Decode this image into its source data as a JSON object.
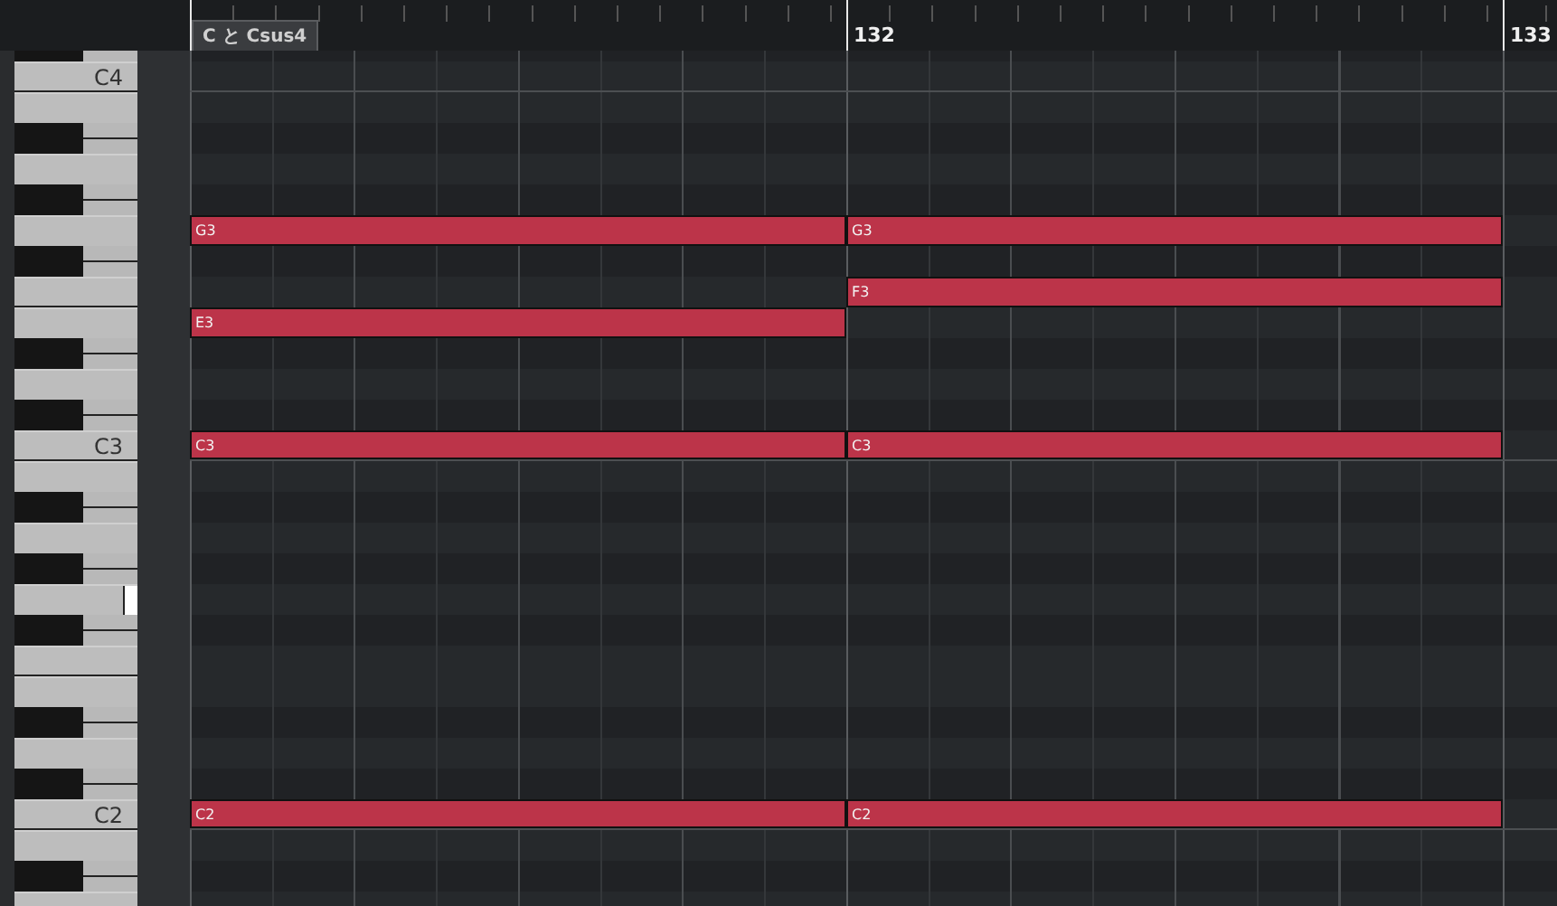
{
  "ruler": {
    "chord": "C と Csus4",
    "markers": [
      "132",
      "133"
    ]
  },
  "keys": [
    {
      "kind": "black",
      "highlighted": false
    },
    {
      "kind": "white-bottom",
      "label": "C4",
      "highlighted": false
    },
    {
      "kind": "white",
      "highlighted": false
    },
    {
      "kind": "black",
      "highlighted": false
    },
    {
      "kind": "white",
      "highlighted": false
    },
    {
      "kind": "black",
      "highlighted": false
    },
    {
      "kind": "white",
      "highlighted": false,
      "notes": [
        {
          "label": "G3",
          "kind": "first-bar"
        },
        {
          "label": "G3",
          "kind": "second-bar"
        }
      ]
    },
    {
      "kind": "black",
      "highlighted": false
    },
    {
      "kind": "white-bottom",
      "highlighted": false,
      "notes": [
        {
          "label": "F3",
          "kind": "second-bar"
        }
      ]
    },
    {
      "kind": "white",
      "highlighted": false,
      "notes": [
        {
          "label": "E3",
          "kind": "first-bar"
        }
      ]
    },
    {
      "kind": "black",
      "highlighted": false
    },
    {
      "kind": "white",
      "highlighted": false
    },
    {
      "kind": "black",
      "highlighted": false
    },
    {
      "kind": "white-bottom",
      "label": "C3",
      "highlighted": false,
      "notes": [
        {
          "label": "C3",
          "kind": "first-bar"
        },
        {
          "label": "C3",
          "kind": "second-bar"
        }
      ]
    },
    {
      "kind": "white",
      "highlighted": false
    },
    {
      "kind": "black",
      "highlighted": false
    },
    {
      "kind": "white",
      "highlighted": false
    },
    {
      "kind": "black",
      "highlighted": false
    },
    {
      "kind": "white",
      "highlighted": true
    },
    {
      "kind": "black",
      "highlighted": false
    },
    {
      "kind": "white-bottom",
      "highlighted": false
    },
    {
      "kind": "white",
      "highlighted": false
    },
    {
      "kind": "black",
      "highlighted": false
    },
    {
      "kind": "white",
      "highlighted": false
    },
    {
      "kind": "black",
      "highlighted": false
    },
    {
      "kind": "white-bottom",
      "label": "C2",
      "highlighted": false,
      "notes": [
        {
          "label": "C2",
          "kind": "first-bar"
        },
        {
          "label": "C2",
          "kind": "second-bar"
        }
      ]
    },
    {
      "kind": "white",
      "highlighted": false
    },
    {
      "kind": "black",
      "highlighted": false
    },
    {
      "kind": "white",
      "highlighted": false
    }
  ]
}
